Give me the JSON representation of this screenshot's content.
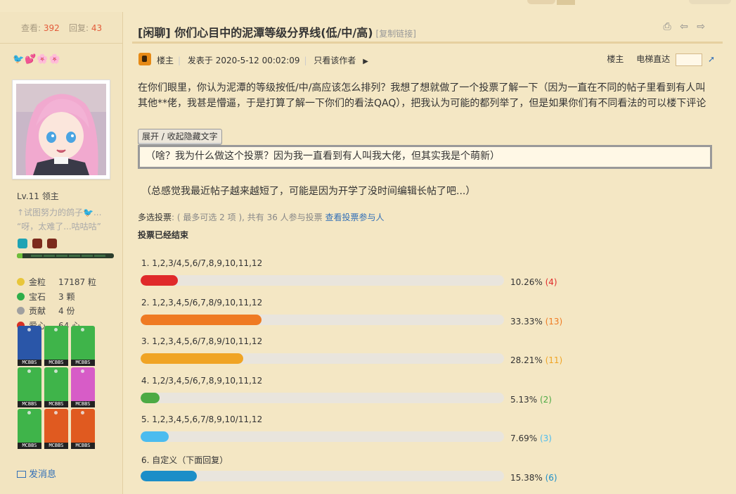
{
  "sidebar": {
    "stats": {
      "views_label": "查看:",
      "views": "392",
      "replies_label": "回复:",
      "replies": "43"
    },
    "username": "🐦💕🌸🌸",
    "level": "Lv.11 领主",
    "signature_line1": "↑试图努力的鸽子🐦...",
    "signature_line2": "“呀，太难了...咕咕咕”",
    "exp_progress": 0.06,
    "credits": [
      {
        "icon": "gold-coin-icon",
        "color": "#e8c63a",
        "label": "金粒",
        "value": "17187 粒"
      },
      {
        "icon": "gem-icon",
        "color": "#2fae4a",
        "label": "宝石",
        "value": "3 颗"
      },
      {
        "icon": "contribution-icon",
        "color": "#a0a0a0",
        "label": "贡献",
        "value": "4 份"
      },
      {
        "icon": "apple-heart-icon",
        "color": "#d63024",
        "label": "爱心",
        "value": "64 心"
      }
    ],
    "medal_tag": "MCBBS",
    "medals": [
      {
        "name": "van-gogh-medal",
        "color": "#2a56a8"
      },
      {
        "name": "book-medal",
        "color": "#3fb44a"
      },
      {
        "name": "map-medal",
        "color": "#3fb44a"
      },
      {
        "name": "leather-medal",
        "color": "#3fb44a"
      },
      {
        "name": "gold-ingot-medal",
        "color": "#3fb44a"
      },
      {
        "name": "apple-medal",
        "color": "#d75cc7"
      },
      {
        "name": "sponge-medal",
        "color": "#3fb44a"
      },
      {
        "name": "seeds-medal",
        "color": "#e05a20"
      },
      {
        "name": "sapling-medal",
        "color": "#e05a20"
      }
    ],
    "pm_label": "发消息"
  },
  "post": {
    "title": "[闲聊] 你们心目中的泥潭等级分界线(低/中/高)",
    "copy_link": "[复制链接]",
    "tools": "⎙ ⇦ ⇨",
    "author_tag": "楼主",
    "posted_at": "发表于 2020-5-12 00:02:09",
    "only_author": "只看该作者",
    "floor_label": "楼主",
    "jump_label": "电梯直达",
    "content": "在你们眼里，你认为泥潭的等级按低/中/高应该怎么排列？我想了想就做了一个投票了解一下（因为一直在不同的帖子里看到有人叫其他**佬，我甚是懵逼，于是打算了解一下你们的看法QAQ），把我认为可能的都列举了，但是如果你们有不同看法的可以楼下评论",
    "toggle_label": "展开 / 收起隐藏文字",
    "hidden_text": "（啥？我为什么做这个投票？因为我一直看到有人叫我大佬，但其实我是个萌新）",
    "note": "（总感觉我最近帖子越来越短了，可能是因为开学了没时间编辑长帖了吧...）"
  },
  "poll": {
    "type_label": "多选投票",
    "info": ": ( 最多可选 2 项 ), 共有 36 人参与投票",
    "view_voters": "查看投票参与人",
    "ended": "投票已经结束",
    "options": [
      {
        "label": "1.  1,2,3/4,5,6/7,8,9,10,11,12",
        "percent": "10.26%",
        "count": "(4)",
        "fill": 0.1026,
        "color": "#e02a2a"
      },
      {
        "label": "2.  1,2,3,4,5/6,7,8/9,10,11,12",
        "percent": "33.33%",
        "count": "(13)",
        "fill": 0.3333,
        "color": "#ef7a22"
      },
      {
        "label": "3.  1,2,3,4,5,6/7,8,9/10,11,12",
        "percent": "28.21%",
        "count": "(11)",
        "fill": 0.2821,
        "color": "#f0a424"
      },
      {
        "label": "4.  1,2/3,4,5/6,7,8,9,10,11,12",
        "percent": "5.13%",
        "count": "(2)",
        "fill": 0.0513,
        "color": "#4caa44"
      },
      {
        "label": "5.  1,2,3,4,5,6,7/8,9,10/11,12",
        "percent": "7.69%",
        "count": "(3)",
        "fill": 0.0769,
        "color": "#4bbcef"
      },
      {
        "label": "6.  自定义（下面回复）",
        "percent": "15.38%",
        "count": "(6)",
        "fill": 0.1538,
        "color": "#1b8ec8"
      }
    ]
  }
}
